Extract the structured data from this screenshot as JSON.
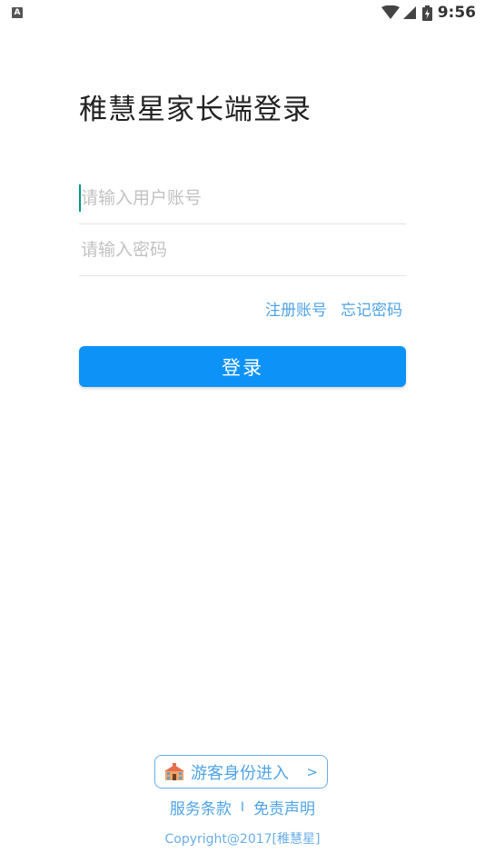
{
  "status_bar": {
    "time": "9:56",
    "notification_icon_letter": "A"
  },
  "page": {
    "title": "稚慧星家长端登录"
  },
  "form": {
    "username_placeholder": "请输入用户账号",
    "password_placeholder": "请输入密码",
    "register_link": "注册账号",
    "forgot_link": "忘记密码",
    "login_button": "登录"
  },
  "footer": {
    "guest_button": "游客身份进入",
    "guest_chevron": ">",
    "terms_link": "服务条款",
    "separator": "I",
    "disclaimer_link": "免责声明",
    "copyright": "Copyright@2017[稚慧星]"
  },
  "colors": {
    "primary": "#0d93f8",
    "link": "#4fa3e6",
    "caret": "#009688"
  }
}
